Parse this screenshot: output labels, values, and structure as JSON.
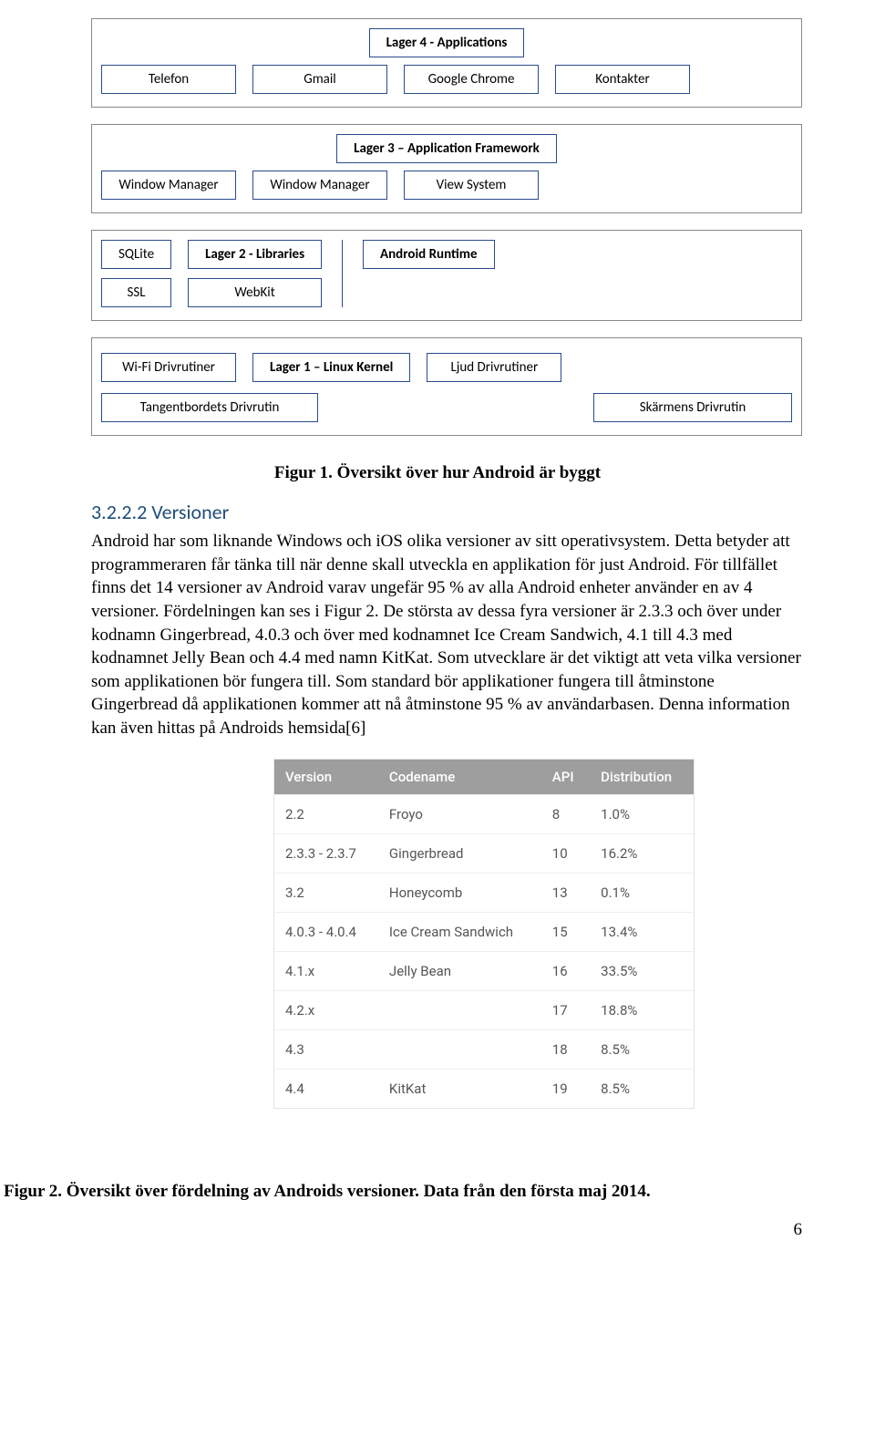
{
  "diagram": {
    "layer4": {
      "header": "Lager 4 - Applications",
      "items": [
        "Telefon",
        "Gmail",
        "Google Chrome",
        "Kontakter"
      ]
    },
    "layer3": {
      "header": "Lager 3 – Application Framework",
      "items": [
        "Window Manager",
        "Window Manager",
        "View System"
      ]
    },
    "layer2": {
      "header": "Lager 2 - Libraries",
      "left_col": [
        "SQLite",
        "SSL"
      ],
      "mid_col": [
        "WebKit"
      ],
      "right_box": "Android Runtime"
    },
    "layer1": {
      "header": "Lager 1 – Linux Kernel",
      "row1_left": "Wi-Fi Drivrutiner",
      "row1_right": "Ljud Drivrutiner",
      "row2_left": "Tangentbordets Drivrutin",
      "row2_right": "Skärmens Drivrutin"
    }
  },
  "fig1_caption": "Figur 1. Översikt över hur Android är byggt",
  "section": {
    "number": "3.2.2.2 Versioner",
    "body": "Android har som liknande Windows och iOS olika versioner av sitt operativsystem. Detta betyder att programmeraren får tänka till när denne skall utveckla en applikation för just Android. För tillfället finns det 14 versioner av Android varav ungefär 95 % av alla Android enheter använder en av 4 versioner. Fördelningen kan ses i Figur 2. De största av dessa fyra versioner är 2.3.3 och över under kodnamn Gingerbread, 4.0.3 och över med kodnamnet Ice Cream Sandwich, 4.1 till 4.3 med kodnamnet Jelly Bean och 4.4 med namn KitKat. Som utvecklare är det viktigt att veta vilka versioner som applikationen bör fungera till. Som standard bör applikationer fungera till åtminstone Gingerbread då applikationen kommer att nå åtminstone 95 % av användarbasen. Denna information kan även hittas på Androids hemsida[6]"
  },
  "chart_data": {
    "type": "table",
    "headers": [
      "Version",
      "Codename",
      "API",
      "Distribution"
    ],
    "rows": [
      [
        "2.2",
        "Froyo",
        "8",
        "1.0%"
      ],
      [
        "2.3.3 - 2.3.7",
        "Gingerbread",
        "10",
        "16.2%"
      ],
      [
        "3.2",
        "Honeycomb",
        "13",
        "0.1%"
      ],
      [
        "4.0.3 - 4.0.4",
        "Ice Cream Sandwich",
        "15",
        "13.4%"
      ],
      [
        "4.1.x",
        "Jelly Bean",
        "16",
        "33.5%"
      ],
      [
        "4.2.x",
        "",
        "17",
        "18.8%"
      ],
      [
        "4.3",
        "",
        "18",
        "8.5%"
      ],
      [
        "4.4",
        "KitKat",
        "19",
        "8.5%"
      ]
    ]
  },
  "fig2_caption": "Figur 2. Översikt över fördelning av Androids versioner. Data från den första maj 2014.",
  "page_number": "6"
}
